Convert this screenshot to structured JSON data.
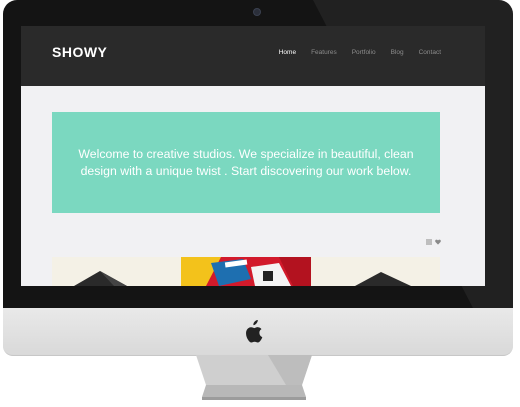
{
  "site": {
    "logo": "SHOWY",
    "nav": [
      {
        "label": "Home",
        "active": true
      },
      {
        "label": "Features",
        "active": false
      },
      {
        "label": "Portfolio",
        "active": false
      },
      {
        "label": "Blog",
        "active": false
      },
      {
        "label": "Contact",
        "active": false
      }
    ]
  },
  "hero": {
    "text": "Welcome to creative studios. We specialize in beautiful, clean design with a unique twist . Start discovering our work below."
  },
  "filter_icons": [
    "list-icon",
    "heart-icon"
  ],
  "colors": {
    "header_bg": "#2a2a2a",
    "hero_bg": "#7bd8c0",
    "page_bg": "#f1f1f3",
    "nav_active": "#ffffff",
    "nav_inactive": "#8c8c8c"
  }
}
